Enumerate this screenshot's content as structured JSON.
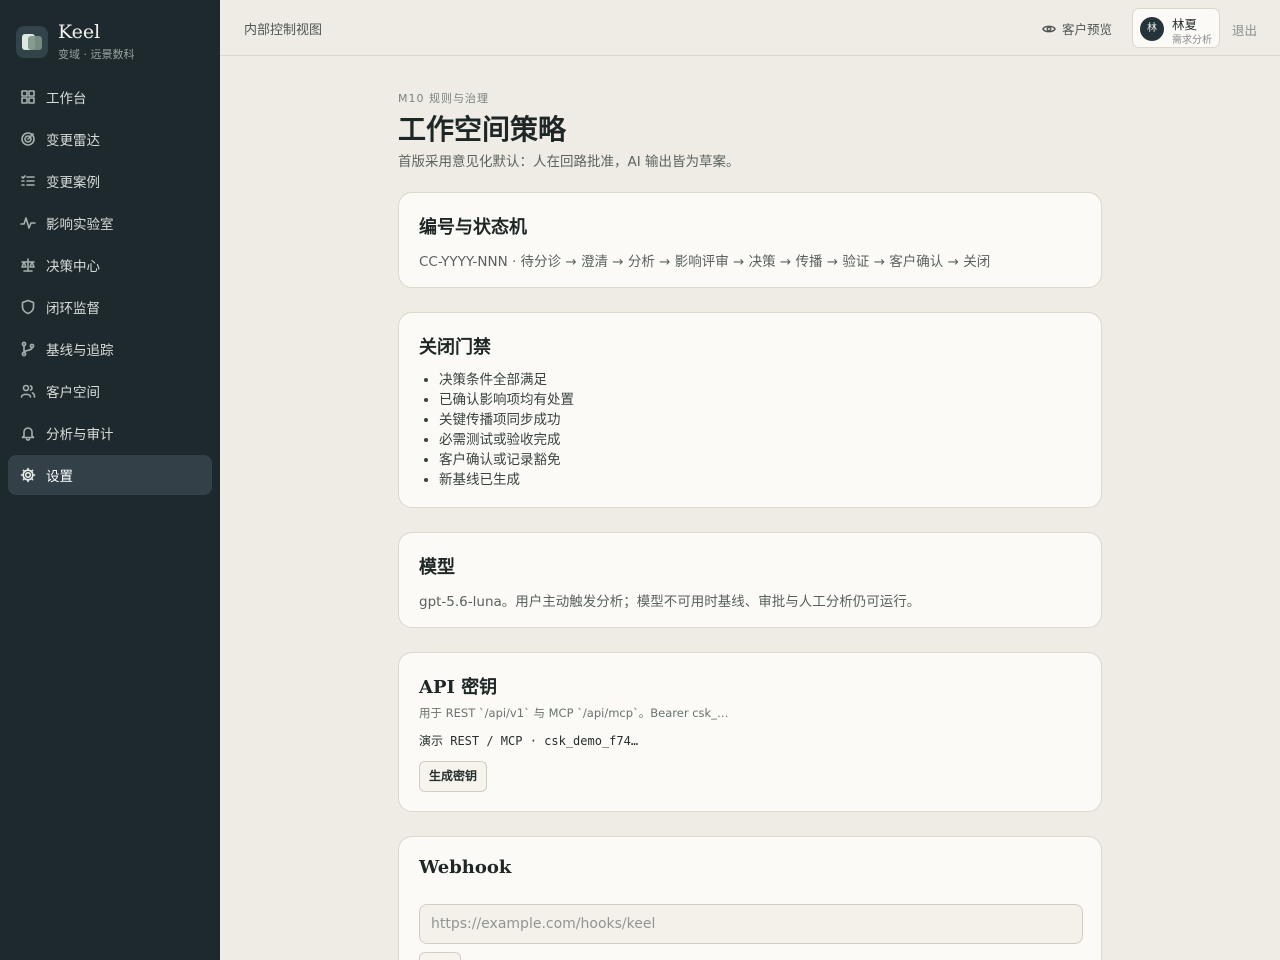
{
  "brand": {
    "name": "Keel",
    "subtitle": "变域 · 远景数科"
  },
  "nav": [
    {
      "label": "工作台",
      "icon": "grid-icon"
    },
    {
      "label": "变更雷达",
      "icon": "radar-icon"
    },
    {
      "label": "变更案例",
      "icon": "list-check-icon"
    },
    {
      "label": "影响实验室",
      "icon": "activity-icon"
    },
    {
      "label": "决策中心",
      "icon": "scale-icon"
    },
    {
      "label": "闭环监督",
      "icon": "shield-icon"
    },
    {
      "label": "基线与追踪",
      "icon": "git-branch-icon"
    },
    {
      "label": "客户空间",
      "icon": "users-icon"
    },
    {
      "label": "分析与审计",
      "icon": "bell-icon"
    },
    {
      "label": "设置",
      "icon": "gear-icon",
      "active": true
    }
  ],
  "topbar": {
    "breadcrumb": "内部控制视图",
    "preview_label": "客户预览",
    "user": {
      "initial": "林",
      "name": "林夏",
      "role": "需求分析"
    },
    "logout_label": "退出"
  },
  "page": {
    "kicker": "M10 规则与治理",
    "title": "工作空间策略",
    "description": "首版采用意见化默认：人在回路批准，AI 输出皆为草案。"
  },
  "cards": {
    "numbering": {
      "title": "编号与状态机",
      "text": "CC-YYYY-NNN · 待分诊 → 澄清 → 分析 → 影响评审 → 决策 → 传播 → 验证 → 客户确认 → 关闭"
    },
    "close_gate": {
      "title": "关闭门禁",
      "items": [
        "决策条件全部满足",
        "已确认影响项均有处置",
        "关键传播项同步成功",
        "必需测试或验收完成",
        "客户确认或记录豁免",
        "新基线已生成"
      ]
    },
    "model": {
      "title": "模型",
      "text": "gpt-5.6-luna。用户主动触发分析；模型不可用时基线、审批与人工分析仍可运行。"
    },
    "api_keys": {
      "title": "API 密钥",
      "description": "用于 REST `/api/v1` 与 MCP `/api/mcp`。Bearer csk_…",
      "key_line": "演示 REST / MCP · csk_demo_f74…",
      "button_label": "生成密钥"
    },
    "webhook": {
      "title": "Webhook",
      "placeholder": "https://example.com/hooks/keel"
    }
  },
  "colors": {
    "sidebar_bg": "#1e292e",
    "page_bg": "#efebe5",
    "card_bg": "#fbfaf6",
    "active_nav": "#334047"
  }
}
